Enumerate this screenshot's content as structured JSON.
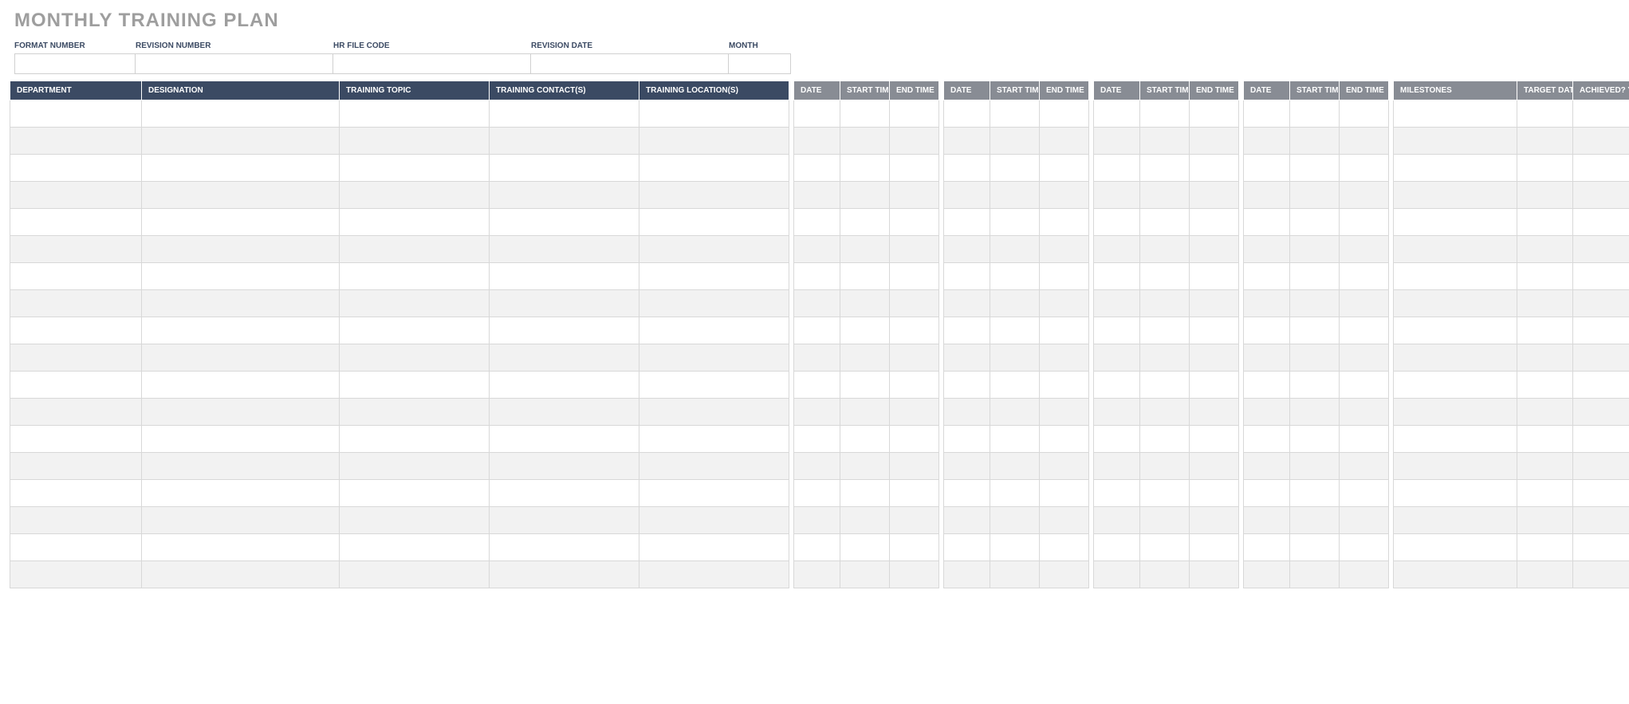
{
  "title": "MONTHLY TRAINING PLAN",
  "meta": {
    "format_number": {
      "label": "FORMAT NUMBER",
      "value": ""
    },
    "revision_number": {
      "label": "REVISION NUMBER",
      "value": ""
    },
    "hr_file_code": {
      "label": "HR FILE CODE",
      "value": ""
    },
    "revision_date": {
      "label": "REVISION DATE",
      "value": ""
    },
    "month": {
      "label": "MONTH",
      "value": ""
    }
  },
  "columns": {
    "department": "DEPARTMENT",
    "designation": "DESIGNATION",
    "training_topic": "TRAINING TOPIC",
    "training_contacts": "TRAINING CONTACT(S)",
    "training_locations": "TRAINING LOCATION(S)",
    "date": "DATE",
    "start_time": "START TIME",
    "end_time": "END TIME",
    "milestones": "MILESTONES",
    "target_date": "TARGET DATE",
    "achieved": "ACHIEVED? Y/N"
  },
  "week_groups": 4,
  "row_count": 18,
  "rows": []
}
